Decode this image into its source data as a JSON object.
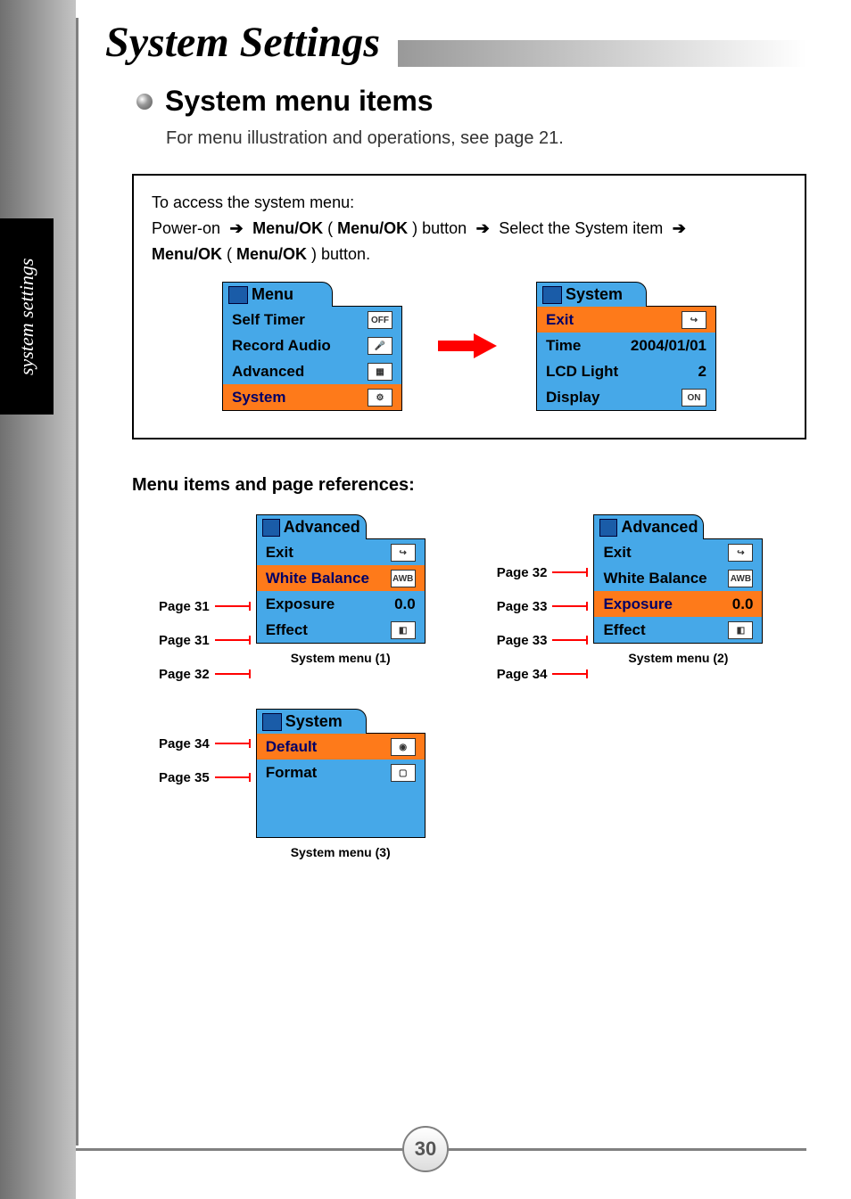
{
  "sidebar_label": "system settings",
  "page_title": "System Settings",
  "section_title": "System menu items",
  "intro_text": "For menu illustration and operations, see page 21.",
  "access": {
    "intro": "To access the system menu:",
    "step1": "Power-on",
    "step2a": "Menu/OK",
    "step2b": "Menu/OK",
    "step2c": ") button",
    "step3": "Select the System item",
    "step4a": "Menu/OK",
    "step4b": "Menu/OK",
    "step4c": ") button."
  },
  "menu_left": {
    "title": "Menu",
    "rows": [
      {
        "label": "Self Timer",
        "icon": "OFF"
      },
      {
        "label": "Record Audio",
        "icon": "🎤"
      },
      {
        "label": "Advanced",
        "icon": "▦"
      },
      {
        "label": "System",
        "icon": "⚙"
      }
    ],
    "selected": 3
  },
  "menu_right": {
    "title": "System",
    "rows": [
      {
        "label": "Exit",
        "icon": "↪"
      },
      {
        "label": "Time",
        "value": "2004/01/01"
      },
      {
        "label": "LCD Light",
        "value": "2"
      },
      {
        "label": "Display",
        "icon": "ON"
      }
    ],
    "selected": 0
  },
  "sub_title": "Menu items and page references:",
  "ref_menus": [
    {
      "title": "Advanced",
      "caption": "System menu (1)",
      "rows": [
        {
          "page": "",
          "label": "Exit",
          "icon": "↪"
        },
        {
          "page": "Page 31",
          "label": "White Balance",
          "icon": "AWB"
        },
        {
          "page": "Page 31",
          "label": "Exposure",
          "value": "0.0"
        },
        {
          "page": "Page 32",
          "label": "Effect",
          "icon": "◧"
        }
      ],
      "selected": 1
    },
    {
      "title": "Advanced",
      "caption": "System menu (2)",
      "rows": [
        {
          "page": "Page 32",
          "label": "Exit",
          "icon": "↪"
        },
        {
          "page": "Page 33",
          "label": "White Balance",
          "icon": "AWB"
        },
        {
          "page": "Page 33",
          "label": "Exposure",
          "value": "0.0"
        },
        {
          "page": "Page 34",
          "label": "Effect",
          "icon": "◧"
        }
      ],
      "selected": 2
    },
    {
      "title": "System",
      "caption": "System menu (3)",
      "rows": [
        {
          "page": "Page 34",
          "label": "Default",
          "icon": "◉"
        },
        {
          "page": "Page 35",
          "label": "Format",
          "icon": "▢"
        },
        {
          "page": "",
          "label": "",
          "icon": ""
        },
        {
          "page": "",
          "label": "",
          "icon": ""
        }
      ],
      "selected": 0
    }
  ],
  "page_number": "30"
}
